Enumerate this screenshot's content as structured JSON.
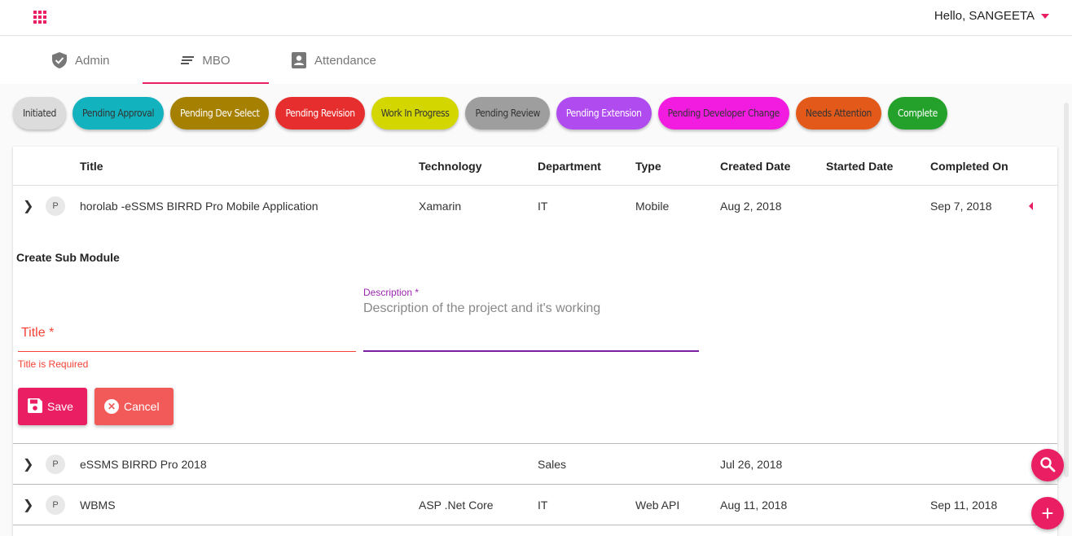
{
  "header": {
    "greeting": "Hello, SANGEETA",
    "brand_color": "#e91e63"
  },
  "nav": {
    "tabs": [
      {
        "label": "Admin",
        "icon": "shield-check-icon"
      },
      {
        "label": "MBO",
        "icon": "notes-lines-icon",
        "active": true
      },
      {
        "label": "Attendance",
        "icon": "badge-icon"
      }
    ]
  },
  "status_chips": [
    {
      "label": "Initiated",
      "color": "#dcdcdc",
      "text_color": "#333333"
    },
    {
      "label": "Pending Approval",
      "color": "#12b3be",
      "text_color": "#333333"
    },
    {
      "label": "Pending Dev Select",
      "color": "#a68000",
      "text_color": "#ffffff"
    },
    {
      "label": "Pending Revision",
      "color": "#e62e2e",
      "text_color": "#ffffff"
    },
    {
      "label": "Work In Progress",
      "color": "#d4d600",
      "text_color": "#333333"
    },
    {
      "label": "Pending Review",
      "color": "#9e9e9e",
      "text_color": "#333333"
    },
    {
      "label": "Pending Extension",
      "color": "#b04bf0",
      "text_color": "#ffffff"
    },
    {
      "label": "Pending Developer Change",
      "color": "#f21ce0",
      "text_color": "#333333"
    },
    {
      "label": "Needs Attention",
      "color": "#e2591a",
      "text_color": "#333333"
    },
    {
      "label": "Complete",
      "color": "#23a12b",
      "text_color": "#ffffff"
    }
  ],
  "table": {
    "columns": {
      "title": "Title",
      "technology": "Technology",
      "department": "Department",
      "type": "Type",
      "created": "Created Date",
      "started": "Started Date",
      "completed": "Completed On"
    },
    "rows": [
      {
        "badge": "P",
        "title": "horolab -eSSMS BIRRD Pro Mobile Application",
        "technology": "Xamarin",
        "department": "IT",
        "type": "Mobile",
        "created": "Aug 2, 2018",
        "started": "",
        "completed": "Sep 7, 2018"
      },
      {
        "badge": "P",
        "title": "eSSMS BIRRD Pro 2018",
        "technology": "",
        "department": "Sales",
        "type": "",
        "created": "Jul 26, 2018",
        "started": "",
        "completed": ""
      },
      {
        "badge": "P",
        "title": "WBMS",
        "technology": "ASP .Net Core",
        "department": "IT",
        "type": "Web API",
        "created": "Aug 11, 2018",
        "started": "",
        "completed": "Sep 11, 2018"
      }
    ]
  },
  "sub_module": {
    "heading": "Create Sub Module",
    "title_label": "Title *",
    "title_value": "",
    "title_error": "Title is Required",
    "description_label": "Description *",
    "description_placeholder": "Description of the project and it's working",
    "description_value": "",
    "save_label": "Save",
    "cancel_label": "Cancel"
  }
}
